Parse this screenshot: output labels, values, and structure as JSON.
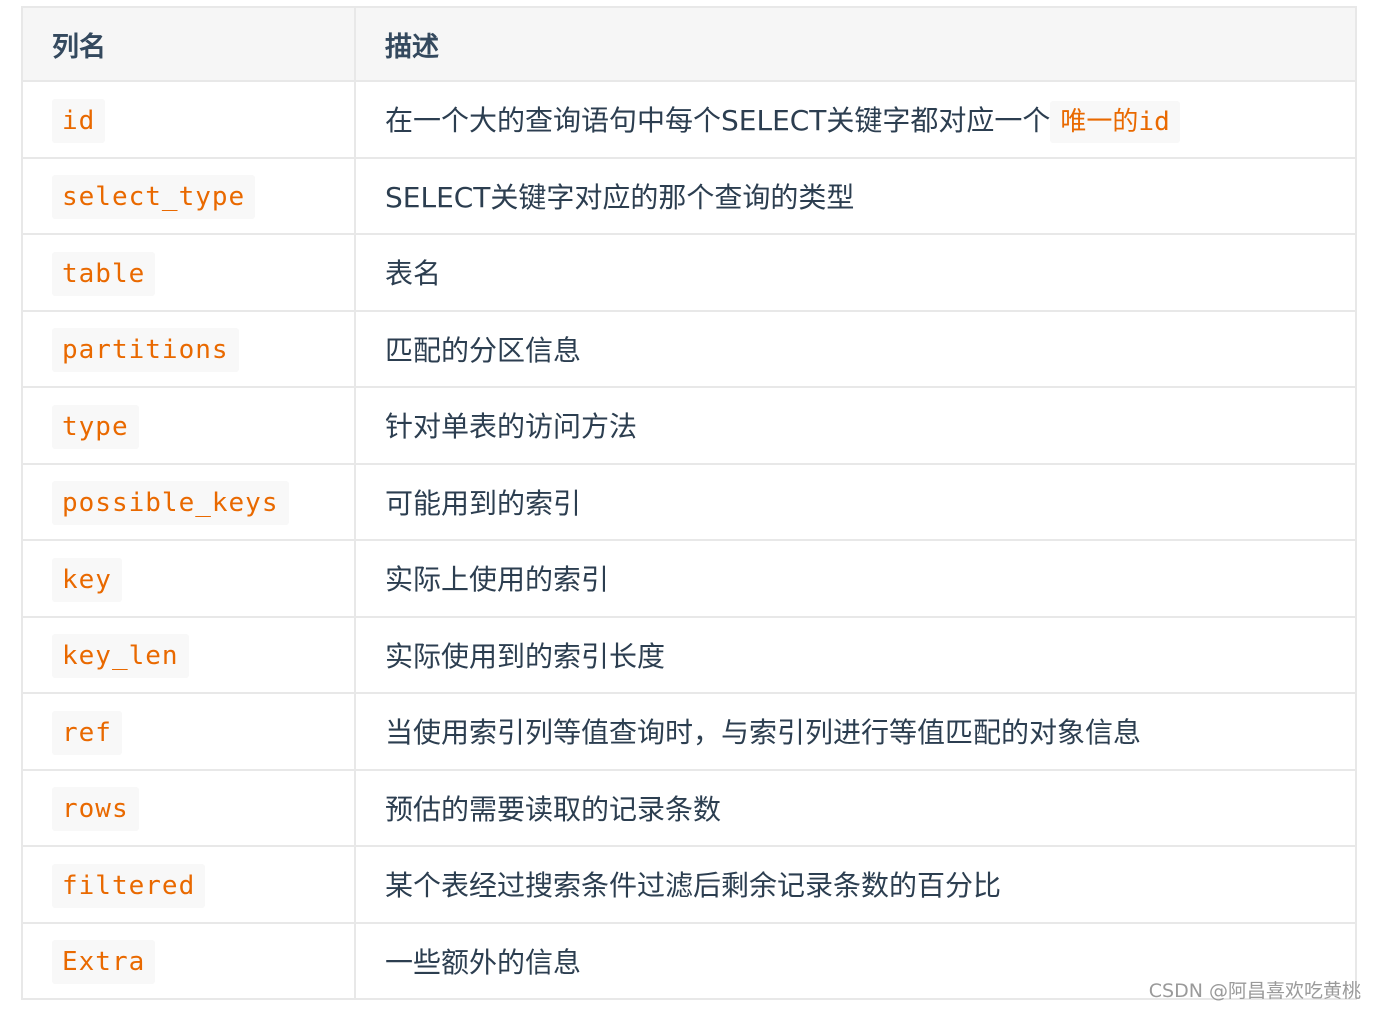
{
  "table": {
    "headers": [
      "列名",
      "描述"
    ],
    "rows": [
      {
        "name": "id",
        "desc": "在一个大的查询语句中每个SELECT关键字都对应一个",
        "desc_code": "唯一的id"
      },
      {
        "name": "select_type",
        "desc": "SELECT关键字对应的那个查询的类型"
      },
      {
        "name": "table",
        "desc": "表名"
      },
      {
        "name": "partitions",
        "desc": "匹配的分区信息"
      },
      {
        "name": "type",
        "desc": "针对单表的访问方法"
      },
      {
        "name": "possible_keys",
        "desc": "可能用到的索引"
      },
      {
        "name": "key",
        "desc": "实际上使用的索引"
      },
      {
        "name": "key_len",
        "desc": "实际使用到的索引长度"
      },
      {
        "name": "ref",
        "desc": "当使用索引列等值查询时，与索引列进行等值匹配的对象信息"
      },
      {
        "name": "rows",
        "desc": "预估的需要读取的记录条数"
      },
      {
        "name": "filtered",
        "desc": "某个表经过搜索条件过滤后剩余记录条数的百分比"
      },
      {
        "name": "Extra",
        "desc": "一些额外的信息"
      }
    ]
  },
  "watermark": "CSDN @阿昌喜欢吃黄桃",
  "colors": {
    "code_text": "#e96900",
    "code_bg": "#f8f8f8",
    "header_bg": "#f6f6f6",
    "border": "#e8e8e8",
    "text": "#2c3e50"
  }
}
